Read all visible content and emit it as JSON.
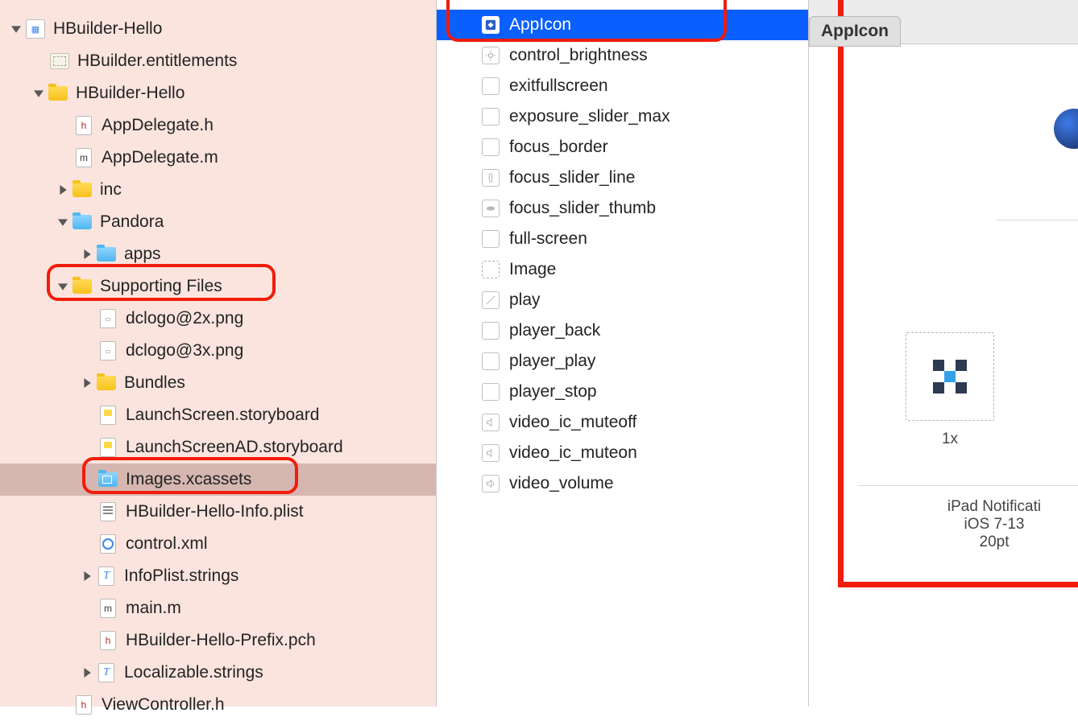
{
  "navigator": {
    "project": "HBuilder-Hello",
    "entitlements": "HBuilder.entitlements",
    "target_folder": "HBuilder-Hello",
    "appdelegate_h": "AppDelegate.h",
    "appdelegate_m": "AppDelegate.m",
    "inc": "inc",
    "pandora": "Pandora",
    "apps": "apps",
    "supporting_files": "Supporting Files",
    "dclogo2x": "dclogo@2x.png",
    "dclogo3x": "dclogo@3x.png",
    "bundles": "Bundles",
    "launchscreen": "LaunchScreen.storyboard",
    "launchscreen_ad": "LaunchScreenAD.storyboard",
    "images_xcassets": "Images.xcassets",
    "info_plist": "HBuilder-Hello-Info.plist",
    "control_xml": "control.xml",
    "infoplist_strings": "InfoPlist.strings",
    "main_m": "main.m",
    "prefix_pch": "HBuilder-Hello-Prefix.pch",
    "localizable_strings": "Localizable.strings",
    "viewcontroller_h": "ViewController.h"
  },
  "assets": {
    "appicon": "AppIcon",
    "control_brightness": "control_brightness",
    "exitfullscreen": "exitfullscreen",
    "exposure_slider_max": "exposure_slider_max",
    "focus_border": "focus_border",
    "focus_slider_line": "focus_slider_line",
    "focus_slider_thumb": "focus_slider_thumb",
    "full_screen": "full-screen",
    "image": "Image",
    "play": "play",
    "player_back": "player_back",
    "player_play": "player_play",
    "player_stop": "player_stop",
    "video_ic_muteoff": "video_ic_muteoff",
    "video_ic_muteon": "video_ic_muteon",
    "video_volume": "video_volume"
  },
  "detail": {
    "tab_title": "AppIcon",
    "scale_1x": "1x",
    "group_line1": "iPad Notificati",
    "group_line2": "iOS 7-13",
    "group_line3": "20pt"
  }
}
